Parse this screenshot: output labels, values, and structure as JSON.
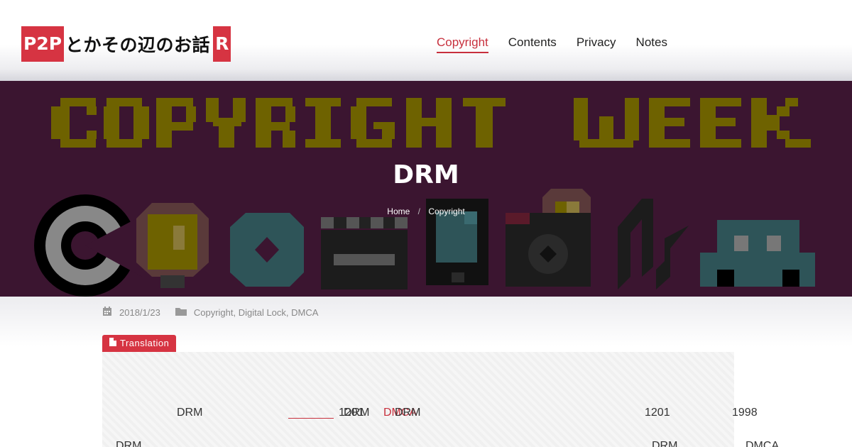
{
  "site": {
    "logo_left": "P2P",
    "logo_text": "とかその辺のお話",
    "logo_right": "R"
  },
  "nav": {
    "items": [
      {
        "label": "Copyright",
        "active": true
      },
      {
        "label": "Contents",
        "active": false
      },
      {
        "label": "Privacy",
        "active": false
      },
      {
        "label": "Notes",
        "active": false
      }
    ]
  },
  "banner": {
    "pixel_text": "COPYRIGHT WEEK",
    "title": "DRM",
    "breadcrumb": {
      "home": "Home",
      "separator": "/",
      "current": "Copyright"
    },
    "icons": [
      "copyright-icon",
      "lightbulb-icon",
      "disc-icon",
      "clapperboard-icon",
      "phone-icon",
      "camera-icon",
      "music-note-icon",
      "car-icon"
    ],
    "colors": {
      "background": "#3b1530",
      "pixel_text": "#6e6200"
    }
  },
  "post": {
    "date": "2018/1/23",
    "categories": "Copyright, Digital Lock, DMCA",
    "badge": "Translation"
  },
  "body_fragments": {
    "l1": [
      "DRM",
      "1201",
      "DRM",
      "DMCA",
      "DRM",
      "1201",
      "1998"
    ],
    "l2": [
      "DRM",
      "DRM",
      "DMCA"
    ]
  },
  "colors": {
    "accent": "#d63442",
    "link": "#c7303d"
  }
}
